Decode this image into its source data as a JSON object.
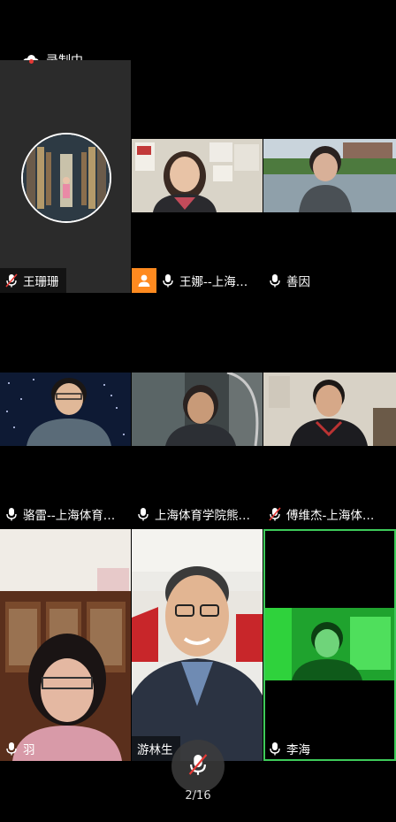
{
  "recording": {
    "label": "录制中"
  },
  "tiles": [
    {
      "name": "王珊珊",
      "muted": true
    },
    {
      "name": "王娜--上海…",
      "muted": false,
      "host": true
    },
    {
      "name": "善因",
      "muted": false
    },
    {
      "name": "骆雷--上海体育…",
      "muted": false
    },
    {
      "name": "上海体育学院熊…",
      "muted": false
    },
    {
      "name": "傅维杰-上海体…",
      "muted": true
    },
    {
      "name": "羽",
      "muted": false
    },
    {
      "name": "游林生",
      "muted": false
    },
    {
      "name": "李海",
      "muted": false,
      "active": true
    }
  ],
  "footer": {
    "page_indicator": "2/16",
    "mic_muted": true
  }
}
